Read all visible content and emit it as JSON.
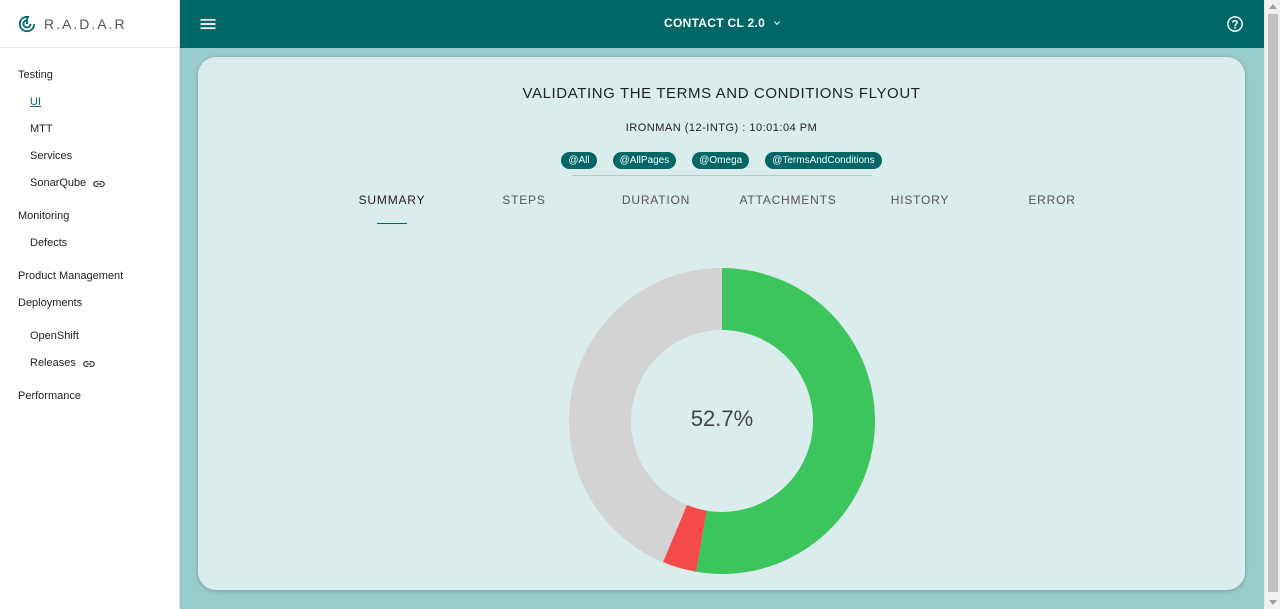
{
  "app": {
    "name": "R.A.D.A.R",
    "logo_icon": "radar-icon"
  },
  "sidebar": {
    "sections": [
      {
        "label": "Testing",
        "items": [
          {
            "label": "UI",
            "active": true
          },
          {
            "label": "MTT"
          },
          {
            "label": "Services"
          },
          {
            "label": "SonarQube",
            "icon": "link-icon"
          }
        ]
      },
      {
        "label": "Monitoring",
        "items": [
          {
            "label": "Defects"
          }
        ]
      },
      {
        "label": "Product Management",
        "items": []
      },
      {
        "label": "Deployments",
        "items": [
          {
            "label": "OpenShift"
          },
          {
            "label": "Releases",
            "icon": "link-icon"
          }
        ]
      },
      {
        "label": "Performance",
        "items": []
      }
    ]
  },
  "topbar": {
    "project": "CONTACT CL 2.0",
    "menu_icon": "hamburger-menu-icon",
    "help_icon": "help-circle-icon",
    "color": "#006666"
  },
  "card": {
    "title": "VALIDATING THE TERMS AND CONDITIONS FLYOUT",
    "subtitle": "IRONMAN (12-INTG) : 10:01:04 PM",
    "tags": [
      "@All",
      "@AllPages",
      "@Omega",
      "@TermsAndConditions"
    ],
    "tabs": [
      {
        "label": "SUMMARY",
        "active": true
      },
      {
        "label": "STEPS"
      },
      {
        "label": "DURATION"
      },
      {
        "label": "ATTACHMENTS"
      },
      {
        "label": "HISTORY"
      },
      {
        "label": "ERROR"
      }
    ]
  },
  "chart_data": {
    "type": "pie",
    "center_label": "52.7%",
    "slices": [
      {
        "value": 52.7,
        "color": "#3cc55c"
      },
      {
        "value": 3.6,
        "color": "#f44a4a"
      },
      {
        "value": 43.7,
        "color": "#d3d3d3"
      }
    ]
  }
}
